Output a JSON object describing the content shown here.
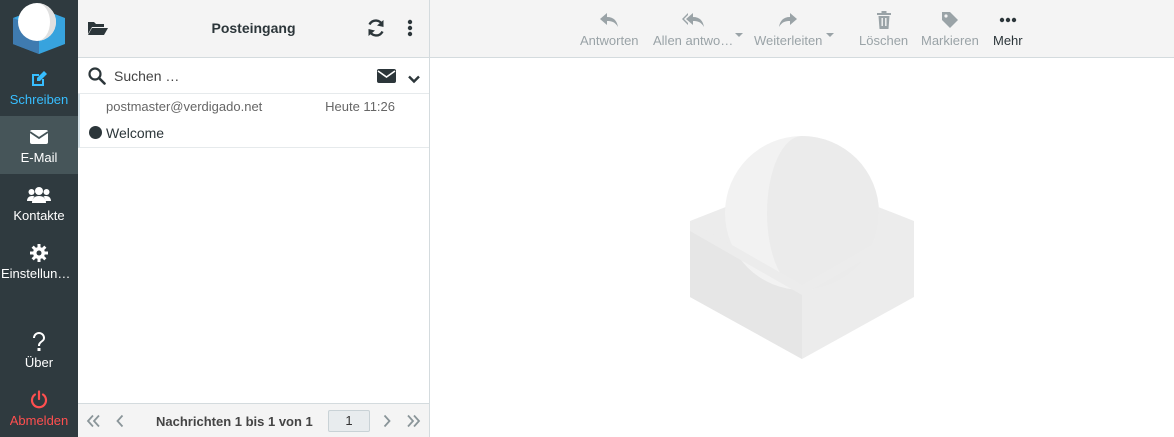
{
  "nav": {
    "items": [
      {
        "label": "Schreiben",
        "icon": "compose-icon"
      },
      {
        "label": "E-Mail",
        "icon": "envelope-icon"
      },
      {
        "label": "Kontakte",
        "icon": "users-icon"
      },
      {
        "label": "Einstellungen",
        "icon": "gear-icon"
      },
      {
        "label": "Über",
        "icon": "question-icon"
      },
      {
        "label": "Abmelden",
        "icon": "power-icon"
      }
    ]
  },
  "list": {
    "title": "Posteingang",
    "search_placeholder": "Suchen …",
    "messages": [
      {
        "from": "postmaster@verdigado.net",
        "date": "Heute 11:26",
        "subject": "Welcome",
        "unread": true
      }
    ],
    "footer": {
      "count_text": "Nachrichten 1 bis 1 von 1",
      "page": "1"
    }
  },
  "toolbar": {
    "buttons": [
      {
        "label": "Antworten",
        "icon": "reply-icon"
      },
      {
        "label": "Allen antwo…",
        "icon": "reply-all-icon"
      },
      {
        "label": "Weiterleiten",
        "icon": "forward-icon"
      },
      {
        "label": "Löschen",
        "icon": "trash-icon"
      },
      {
        "label": "Markieren",
        "icon": "tag-icon"
      },
      {
        "label": "Mehr",
        "icon": "more-icon"
      }
    ]
  },
  "colors": {
    "nav_bg": "#2f3a3f",
    "nav_selected": "#465559",
    "compose_accent": "#37beff",
    "logout_accent": "#ff4f4f"
  }
}
